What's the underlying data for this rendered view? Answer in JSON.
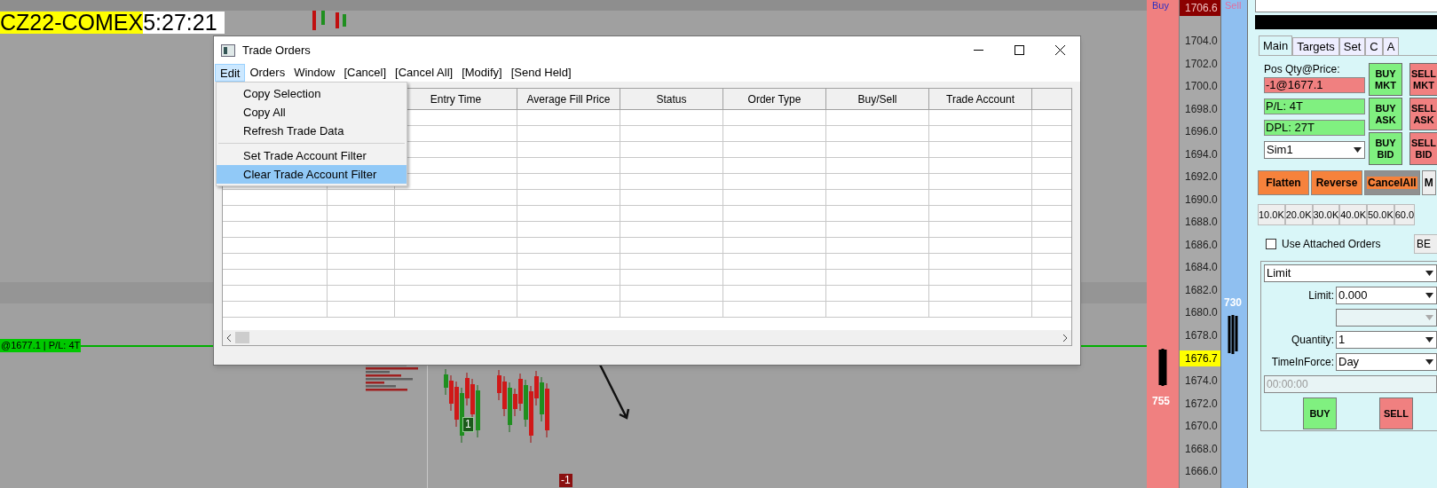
{
  "chart": {
    "symbol": "CZ22-COMEX",
    "timer": "5:27:21",
    "position_label": "@1677.1 | P/L: 4T",
    "markers": [
      {
        "text": "1",
        "kind": "buy"
      },
      {
        "text": "-1",
        "kind": "sell"
      }
    ]
  },
  "dialog": {
    "title": "Trade Orders",
    "menu": [
      {
        "label": "Edit",
        "selected": true
      },
      {
        "label": "Orders",
        "selected": false
      },
      {
        "label": "Window",
        "selected": false
      },
      {
        "label": "[Cancel]",
        "selected": false
      },
      {
        "label": "[Cancel All]",
        "selected": false
      },
      {
        "label": "[Modify]",
        "selected": false
      },
      {
        "label": "[Send Held]",
        "selected": false
      }
    ],
    "dropdown": [
      {
        "label": "Copy Selection",
        "selected": false,
        "kind": "item"
      },
      {
        "label": "Copy All",
        "selected": false,
        "kind": "item"
      },
      {
        "label": "Refresh Trade Data",
        "selected": false,
        "kind": "item"
      },
      {
        "kind": "separator"
      },
      {
        "label": "Set Trade Account Filter",
        "selected": false,
        "kind": "item"
      },
      {
        "label": "Clear Trade Account Filter",
        "selected": true,
        "kind": "item"
      }
    ],
    "columns": [
      "Entry Time",
      "Average Fill Price",
      "Status",
      "Order Type",
      "Buy/Sell",
      "Trade Account"
    ]
  },
  "ladder": {
    "buy_header": "Buy",
    "sell_header": "Sell",
    "buy_volume": "755",
    "sell_volume": "730",
    "prices": [
      {
        "price": "1706.6",
        "kind": "high"
      },
      {
        "price": "1704.0",
        "kind": "plain"
      },
      {
        "price": "1702.0",
        "kind": "plain"
      },
      {
        "price": "1700.0",
        "kind": "plain"
      },
      {
        "price": "1698.0",
        "kind": "plain"
      },
      {
        "price": "1696.0",
        "kind": "plain"
      },
      {
        "price": "1694.0",
        "kind": "plain"
      },
      {
        "price": "1692.0",
        "kind": "plain"
      },
      {
        "price": "1690.0",
        "kind": "plain"
      },
      {
        "price": "1688.0",
        "kind": "plain"
      },
      {
        "price": "1686.0",
        "kind": "plain"
      },
      {
        "price": "1684.0",
        "kind": "plain"
      },
      {
        "price": "1682.0",
        "kind": "plain"
      },
      {
        "price": "1680.0",
        "kind": "plain"
      },
      {
        "price": "1678.0",
        "kind": "plain"
      },
      {
        "price": "1676.7",
        "kind": "current"
      },
      {
        "price": "1674.0",
        "kind": "plain"
      },
      {
        "price": "1672.0",
        "kind": "plain"
      },
      {
        "price": "1670.0",
        "kind": "plain"
      },
      {
        "price": "1668.0",
        "kind": "plain"
      },
      {
        "price": "1666.0",
        "kind": "plain"
      }
    ]
  },
  "panel": {
    "tabs": [
      {
        "label": "Main",
        "selected": true
      },
      {
        "label": "Targets",
        "selected": false
      },
      {
        "label": "Set",
        "selected": false
      },
      {
        "label": "C",
        "selected": false
      },
      {
        "label": "A",
        "selected": false
      }
    ],
    "pos_label": "Pos Qty@Price:",
    "position": "-1@1677.1",
    "pl": "P/L: 4T",
    "dpl": "DPL: 27T",
    "account": "Sim1",
    "buy_buttons": [
      [
        "BUY",
        "MKT"
      ],
      [
        "BUY",
        "ASK"
      ],
      [
        "BUY",
        "BID"
      ]
    ],
    "sell_buttons": [
      [
        "SELL",
        "MKT"
      ],
      [
        "SELL",
        "ASK"
      ],
      [
        "SELL",
        "BID"
      ]
    ],
    "actions": [
      "Flatten",
      "Reverse",
      "CancelAll",
      "M"
    ],
    "sizes": [
      "10.0K",
      "20.0K",
      "30.0K",
      "40.0K",
      "50.0K",
      "60.0"
    ],
    "attached": {
      "label": "Use Attached Orders",
      "checked": false
    },
    "be": "BE",
    "order_type": "Limit",
    "limit_label": "Limit:",
    "limit": "0.000",
    "quantity_label": "Quantity:",
    "quantity": "1",
    "tif_label": "TimeInForce:",
    "tif": "Day",
    "time_placeholder": "00:00:00",
    "buy": "BUY",
    "sell": "SELL"
  }
}
